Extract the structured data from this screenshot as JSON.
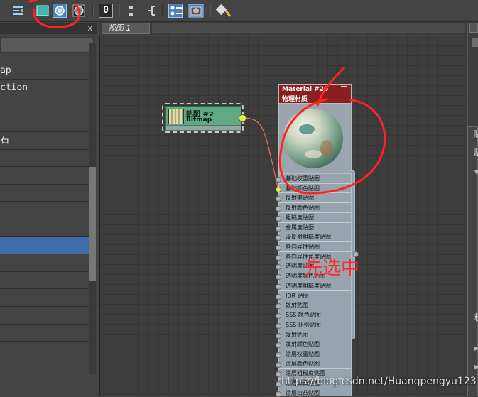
{
  "colors": {
    "active_tool": "#4d7fb8",
    "bitmap_node": "#5fa985",
    "material_header": "#8a1f1f",
    "socket_active": "#e4f23a",
    "annotation_red": "#ff2a2a"
  },
  "toolbar": {
    "icons": [
      "layout-icon",
      "material-preview-icon",
      "show-map-icon",
      "checker-sphere-icon",
      "lay-out-children-icon",
      "node-tree-icon",
      "options-icon",
      "pick-material-icon"
    ],
    "number_button": "0"
  },
  "left_panel": {
    "close": "x",
    "rows": [
      "",
      "ap",
      "ction",
      "",
      "",
      "石",
      "",
      "",
      "",
      "",
      "",
      "",
      "",
      "",
      "",
      "",
      "",
      "",
      "",
      "",
      ""
    ],
    "selected_row_index": 11
  },
  "view": {
    "tab_label": "视图 1"
  },
  "bitmap_node": {
    "title": "贴图 #2",
    "subtitle": "Bitmap"
  },
  "material_node": {
    "title": "Material #26",
    "subtitle": "物理材质",
    "minimize": "–",
    "slots": [
      "基础权重贴图",
      "基础颜色贴图",
      "反射率贴图",
      "反射颜色贴图",
      "粗糙度贴图",
      "金属度贴图",
      "漫反射粗糙度贴图",
      "各向异性贴图",
      "各向异性角度贴图",
      "透明度贴图",
      "透明度颜色贴图",
      "透明度粗糙度贴图",
      "IOR 贴图",
      "散射贴图",
      "SSS 颜色贴图",
      "SSS 比例贴图",
      "发射贴图",
      "发射颜色贴图",
      "涂层权重贴图",
      "涂层颜色贴图",
      "涂层粗糙度贴图",
      "涂层凹凸贴图",
      "涂层凹凸贴图"
    ],
    "connected_slot_index": 1
  },
  "right_panel": {
    "top_char": "贴",
    "char2": "贴",
    "char3": "糙"
  },
  "annotation": {
    "text": "先选中"
  },
  "watermark": "https://blog.csdn.net/Huangpengyu123"
}
